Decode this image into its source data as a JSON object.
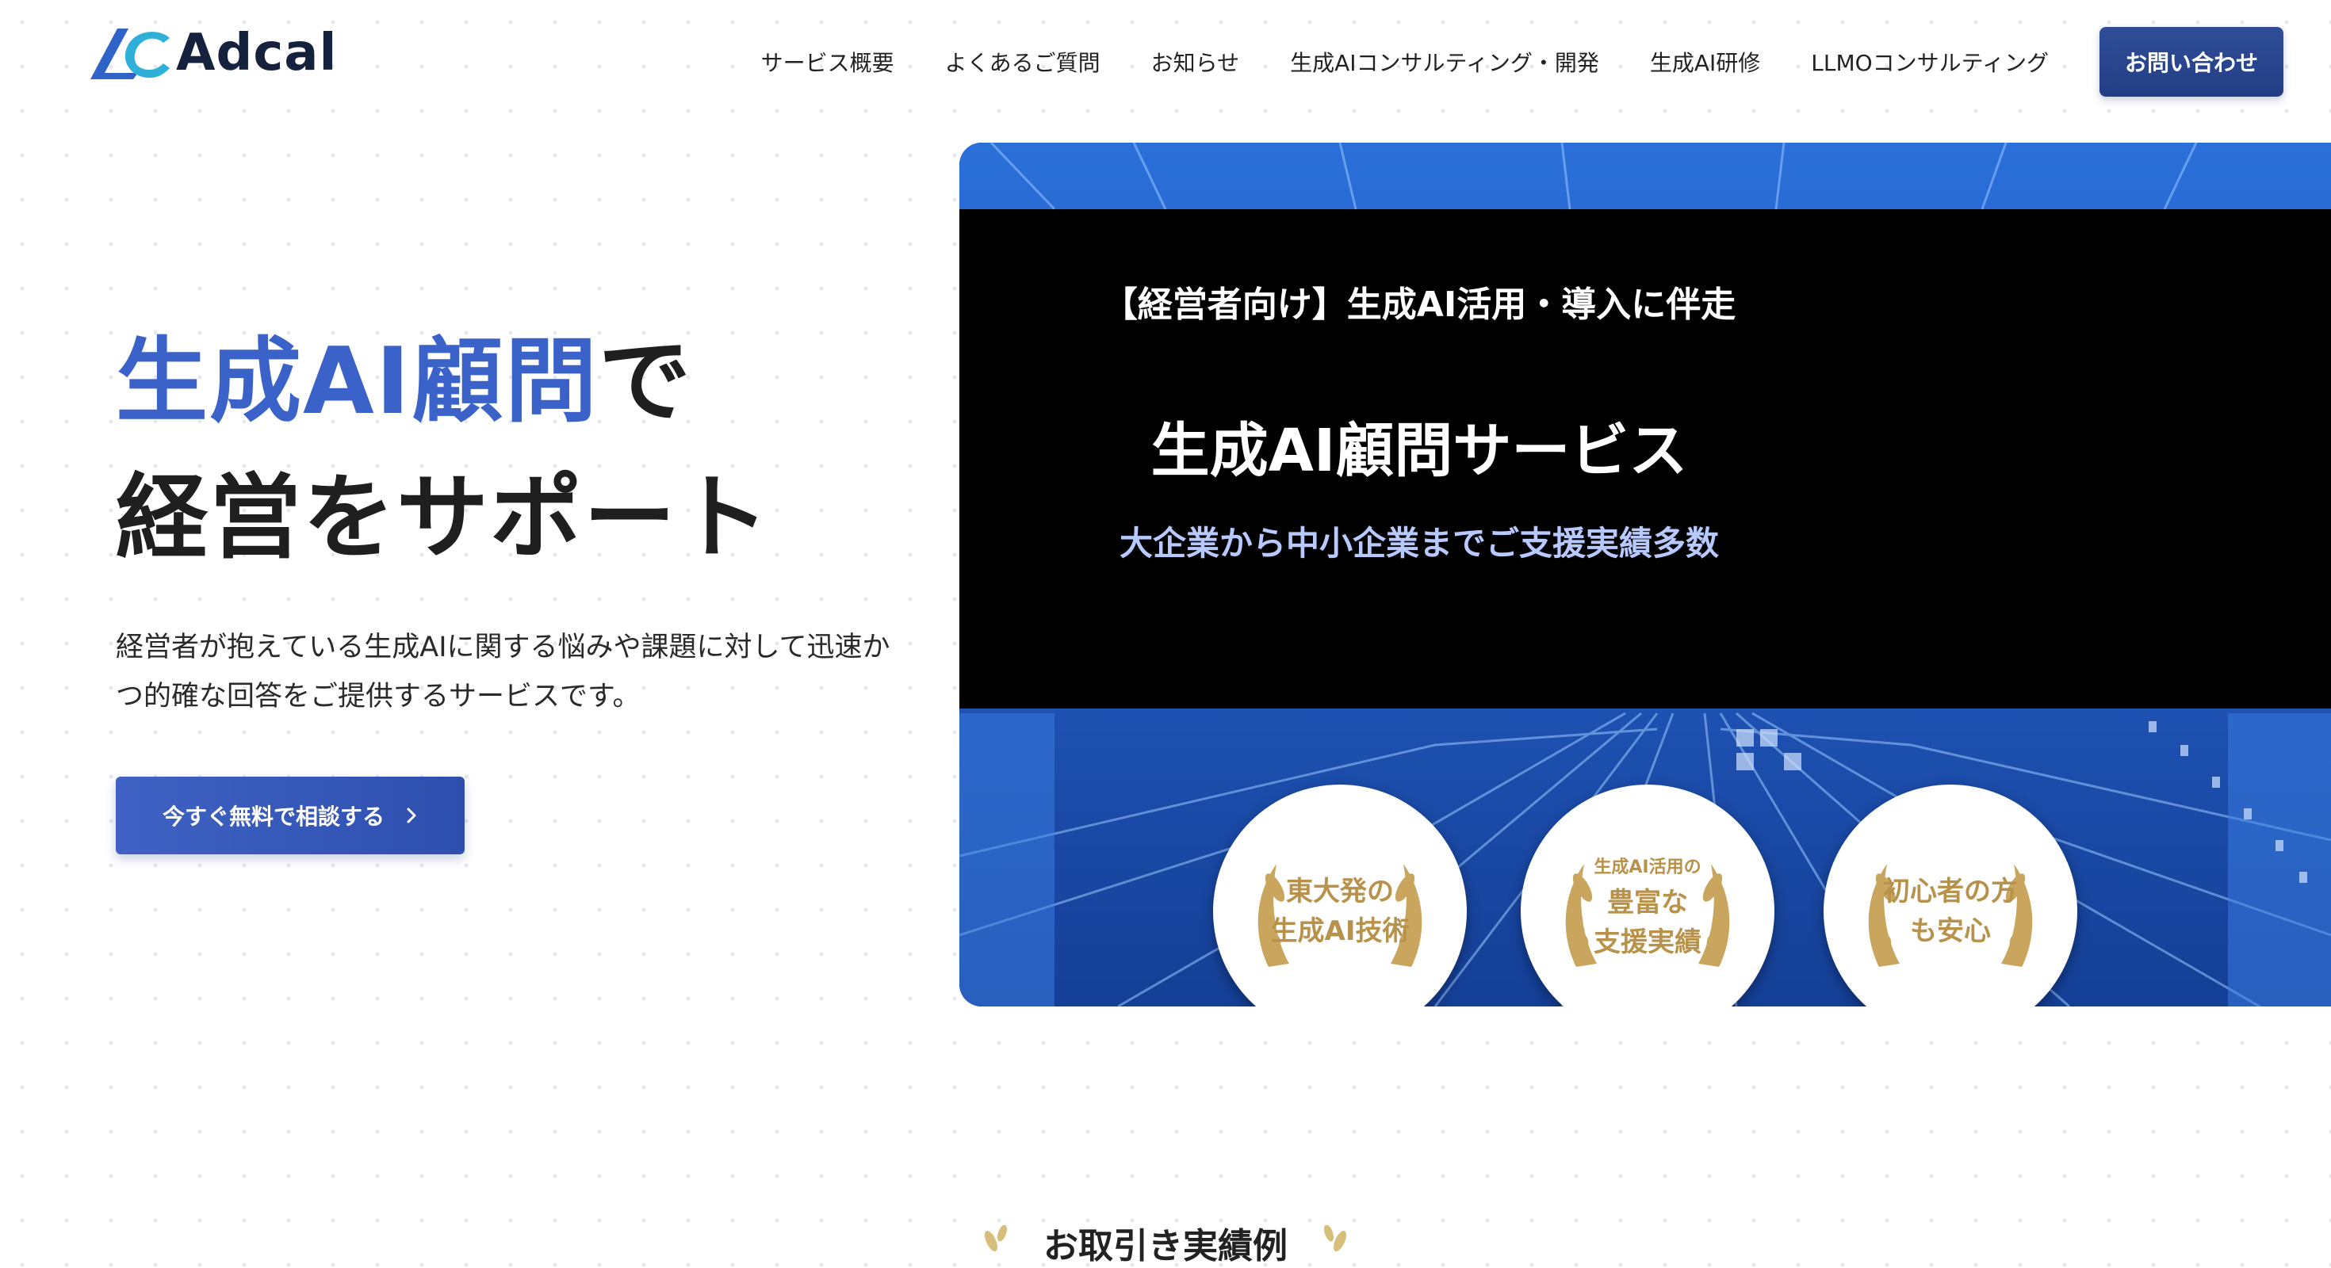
{
  "header": {
    "logo_text": "Adcal",
    "nav": [
      "サービス概要",
      "よくあるご質問",
      "お知らせ",
      "生成AIコンサルティング・開発",
      "生成AI研修",
      "LLMOコンサルティング"
    ],
    "cta_label": "お問い合わせ"
  },
  "hero": {
    "title_accent": "生成AI顧問",
    "title_suffix": "で",
    "title_line2": "経営をサポート",
    "description": "経営者が抱えている生成AIに関する悩みや課題に対して迅速かつ的確な回答をご提供するサービスです。",
    "cta_label": "今すぐ無料で相談する"
  },
  "banner": {
    "subtitle": "【経営者向け】生成AI活用・導入に伴走",
    "title": "生成AI顧問サービス",
    "tagline": "大企業から中小企業までご支援実績多数",
    "medals": [
      {
        "small": "",
        "lines": [
          "東大発の",
          "生成AI技術"
        ]
      },
      {
        "small": "生成AI活用の",
        "lines": [
          "豊富な",
          "支援実績"
        ]
      },
      {
        "small": "",
        "lines": [
          "初心者の方",
          "も安心"
        ]
      }
    ]
  },
  "section": {
    "title": "お取引き実績例"
  },
  "colors": {
    "accent": "#3a62c9",
    "nav_cta": "#2a4690",
    "gold": "#b8924a",
    "banner_blue": "#1f57c2"
  }
}
